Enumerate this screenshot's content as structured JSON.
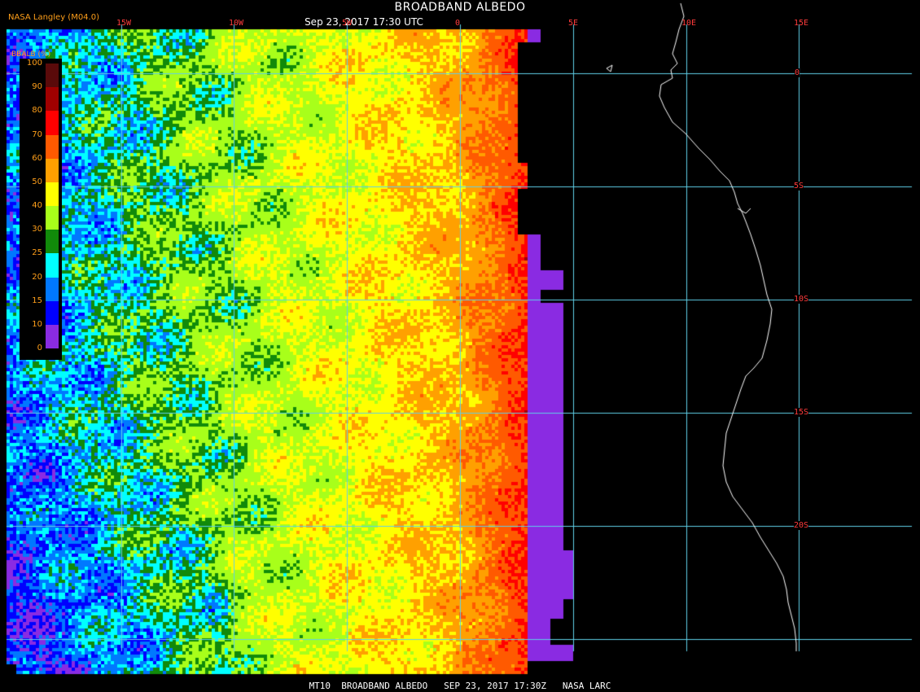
{
  "header": {
    "title": "BROADBAND ALBEDO",
    "subtitle": "Sep 23, 2017 17:30 UTC",
    "credit": "NASA Langley (M04.0)"
  },
  "footer": {
    "text": "MT10  BROADBAND ALBEDO   SEP 23, 2017 17:30Z   NASA LARC"
  },
  "legend": {
    "title": "BBALB (%)",
    "labels": [
      "100",
      "90",
      "80",
      "70",
      "60",
      "50",
      "40",
      "30",
      "25",
      "20",
      "15",
      "10",
      "0"
    ],
    "colors": [
      "#5a0a0a",
      "#a00000",
      "#ff0000",
      "#ff5a00",
      "#ffa000",
      "#ffff00",
      "#a8ff1a",
      "#118a0a",
      "#00ffff",
      "#0078ff",
      "#0000ff",
      "#8a2be2"
    ]
  },
  "axes": {
    "lon_labels": [
      "15W",
      "10W",
      "5W",
      "0",
      "5E",
      "10E",
      "15E"
    ],
    "lat_labels": [
      "0",
      "5S",
      "10S",
      "15S",
      "20S"
    ]
  },
  "colors": {
    "grid": "#5fd0e8",
    "coast": "#ffffff",
    "label": "#ff3b3b",
    "background": "#000000"
  }
}
